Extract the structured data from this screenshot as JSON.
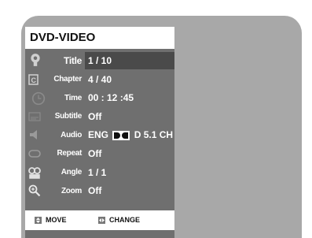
{
  "menu": {
    "title": "DVD-VIDEO",
    "rows": [
      {
        "label": "Title",
        "value": "1 / 10",
        "icon": "title-icon"
      },
      {
        "label": "Chapter",
        "value": "4 / 40",
        "icon": "chapter-icon"
      },
      {
        "label": "Time",
        "value": "00 : 12 :45",
        "icon": "clock-icon"
      },
      {
        "label": "Subtitle",
        "value": "Off",
        "icon": "subtitle-icon"
      },
      {
        "label": "Audio",
        "value_prefix": "ENG",
        "value_suffix": "D 5.1 CH",
        "icon": "speaker-icon"
      },
      {
        "label": "Repeat",
        "value": "Off",
        "icon": "repeat-icon"
      },
      {
        "label": "Angle",
        "value": "1 / 1",
        "icon": "camera-icon"
      },
      {
        "label": "Zoom",
        "value": "Off",
        "icon": "zoom-icon"
      }
    ]
  },
  "footer": {
    "move_label": "MOVE",
    "change_label": "CHANGE"
  },
  "colors": {
    "screen_bg": "#a8a8a8",
    "menu_bg": "#6f6f6f",
    "selected_bg": "#4a4a4a"
  }
}
